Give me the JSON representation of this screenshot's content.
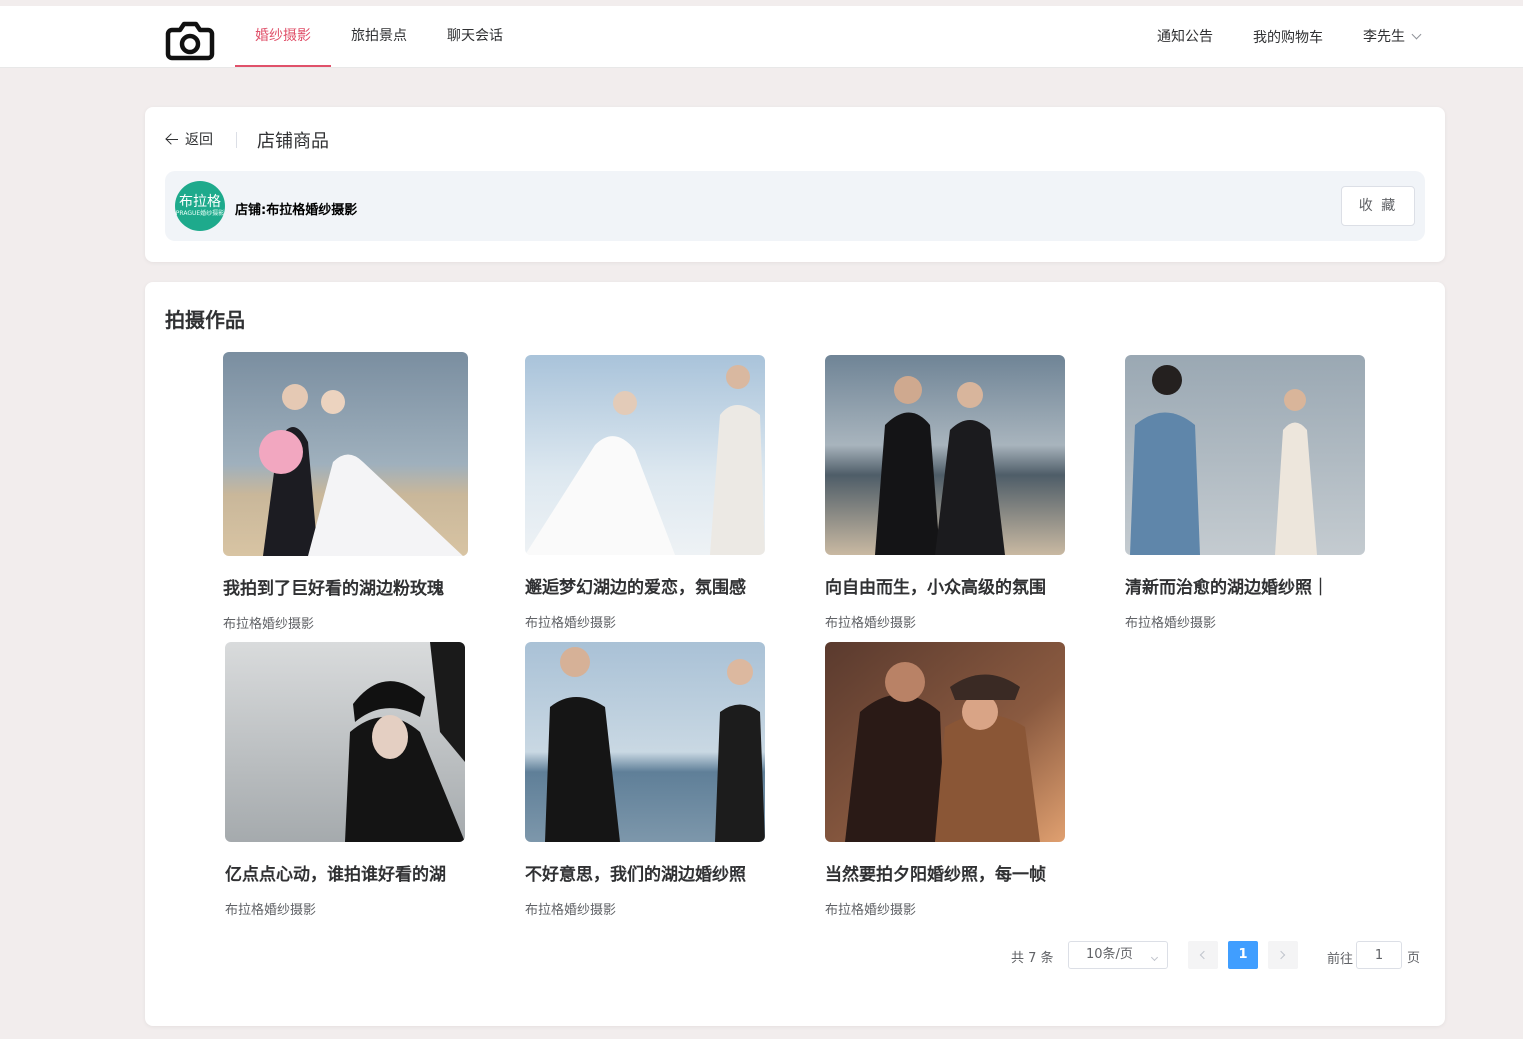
{
  "nav": {
    "items": [
      {
        "label": "婚纱摄影",
        "active": true
      },
      {
        "label": "旅拍景点",
        "active": false
      },
      {
        "label": "聊天会话",
        "active": false
      }
    ],
    "notice": "通知公告",
    "cart": "我的购物车",
    "user": "李先生"
  },
  "header": {
    "back_label": "返回",
    "title": "店铺商品"
  },
  "shop": {
    "avatar_text": "布拉格",
    "avatar_sub": "PRAGUE婚纱摄影",
    "name": "店铺:布拉格婚纱摄影",
    "fav_label": "收 藏"
  },
  "works": {
    "section_title": "拍摄作品",
    "items": [
      {
        "title": "我拍到了巨好看的湖边粉玫瑰",
        "shop": "布拉格婚纱摄影"
      },
      {
        "title": "邂逅梦幻湖边的爱恋，氛围感",
        "shop": "布拉格婚纱摄影"
      },
      {
        "title": "向自由而生，小众高级的氛围",
        "shop": "布拉格婚纱摄影"
      },
      {
        "title": "清新而治愈的湖边婚纱照｜",
        "shop": "布拉格婚纱摄影"
      },
      {
        "title": "亿点点心动，谁拍谁好看的湖",
        "shop": "布拉格婚纱摄影"
      },
      {
        "title": "不好意思，我们的湖边婚纱照",
        "shop": "布拉格婚纱摄影"
      },
      {
        "title": "当然要拍夕阳婚纱照，每一帧",
        "shop": "布拉格婚纱摄影"
      }
    ]
  },
  "pagination": {
    "total_label": "共 7 条",
    "page_size": "10条/页",
    "current_page": "1",
    "goto_label": "前往",
    "goto_value": "1",
    "page_unit": "页"
  },
  "colors": {
    "accent": "#e0516a",
    "page_active": "#409eff",
    "background": "#f2eded"
  }
}
